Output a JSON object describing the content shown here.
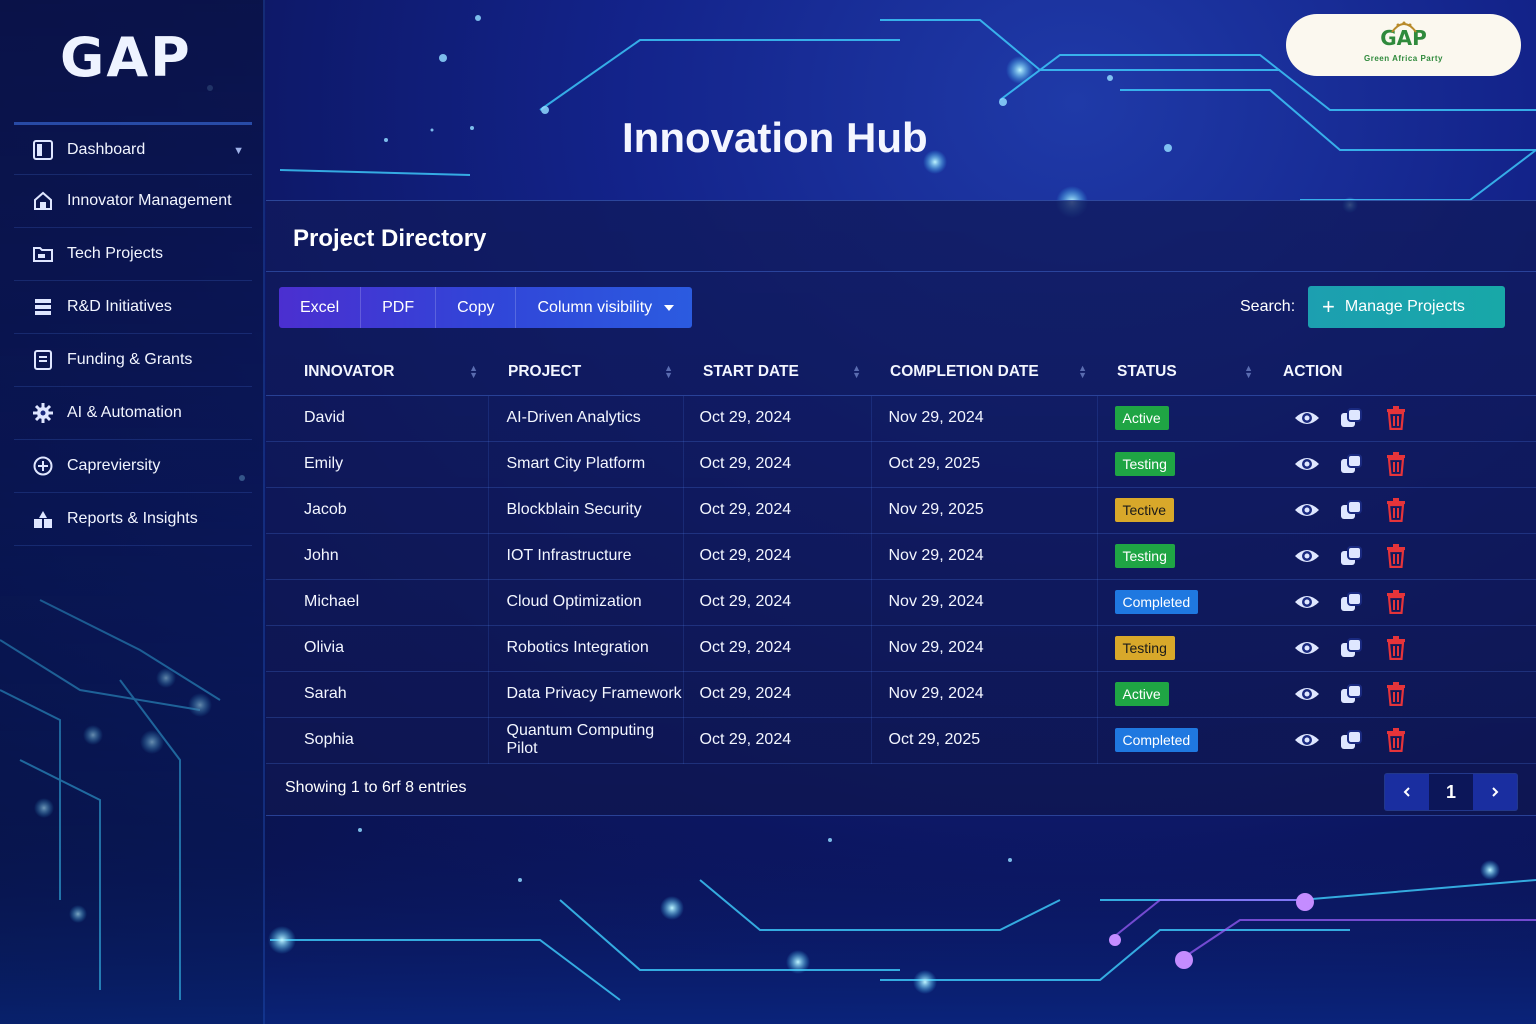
{
  "brand": "GAP",
  "logo": {
    "title": "GAP",
    "subtitle": "Green Africa Party"
  },
  "page_title": "Innovation Hub",
  "sidebar": {
    "items": [
      {
        "label": "Dashboard",
        "icon": "dashboard-icon"
      },
      {
        "label": "Innovator Management",
        "icon": "home-icon"
      },
      {
        "label": "Tech Projects",
        "icon": "folder-icon"
      },
      {
        "label": "R&D Initiatives",
        "icon": "layers-icon"
      },
      {
        "label": "Funding & Grants",
        "icon": "document-icon"
      },
      {
        "label": "AI & Automation",
        "icon": "gear-icon"
      },
      {
        "label": "Capreviersity",
        "icon": "plus-circle-icon"
      },
      {
        "label": "Reports & Insights",
        "icon": "reports-icon"
      }
    ]
  },
  "panel": {
    "title": "Project Directory",
    "buttons": {
      "excel": "Excel",
      "pdf": "PDF",
      "copy": "Copy",
      "column_visibility": "Column visibility"
    },
    "search_label": "Search:",
    "manage_label": "Manage Projects"
  },
  "table": {
    "headers": [
      "INNOVATOR",
      "PROJECT",
      "START DATE",
      "COMPLETION DATE",
      "STATUS",
      "ACTION"
    ],
    "rows": [
      {
        "innovator": "David",
        "project": "AI-Driven Analytics",
        "start": "Oct 29, 2024",
        "end": "Nov 29, 2024",
        "status": "Active",
        "color": "green"
      },
      {
        "innovator": "Emily",
        "project": "Smart City Platform",
        "start": "Oct 29, 2024",
        "end": "Oct 29, 2025",
        "status": "Testing",
        "color": "green"
      },
      {
        "innovator": "Jacob",
        "project": "Blockblain Security",
        "start": "Oct 29, 2024",
        "end": "Nov 29, 2025",
        "status": "Tective",
        "color": "yellow"
      },
      {
        "innovator": "John",
        "project": "IOT Infrastructure",
        "start": "Oct 29, 2024",
        "end": "Nov 29, 2024",
        "status": "Testing",
        "color": "green"
      },
      {
        "innovator": "Michael",
        "project": "Cloud Optimization",
        "start": "Oct 29, 2024",
        "end": "Nov 29, 2024",
        "status": "Completed",
        "color": "blue"
      },
      {
        "innovator": "Olivia",
        "project": "Robotics Integration",
        "start": "Oct 29, 2024",
        "end": "Nov 29, 2024",
        "status": "Testing",
        "color": "yellow"
      },
      {
        "innovator": "Sarah",
        "project": "Data Privacy Framework",
        "start": "Oct 29, 2024",
        "end": "Nov 29, 2024",
        "status": "Active",
        "color": "green"
      },
      {
        "innovator": "Sophia",
        "project": "Quantum Computing Pilot",
        "start": "Oct 29, 2024",
        "end": "Oct 29, 2025",
        "status": "Completed",
        "color": "blue"
      }
    ]
  },
  "footer": {
    "showing": "Showing 1 to 6rf 8 entries",
    "page": "1"
  },
  "colors": {
    "active_green": "#1fa544",
    "warning_yellow": "#d8a82a",
    "info_blue": "#1f78e0",
    "teal_button": "#1c9fb0",
    "delete_red": "#e5343a"
  }
}
